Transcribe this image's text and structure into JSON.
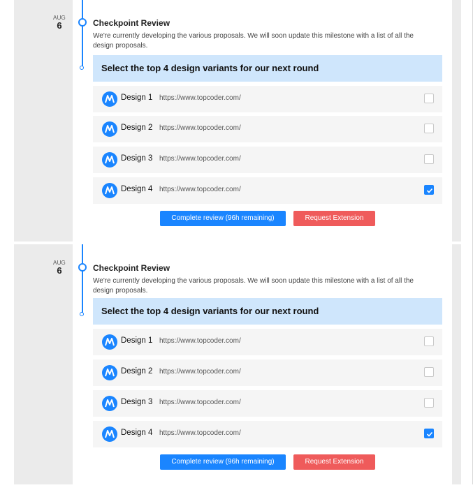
{
  "milestones": [
    {
      "date": {
        "month": "AUG",
        "day": "6"
      },
      "title": "Checkpoint Review",
      "description": "We're currently developing the various proposals. We will soon update this milestone with a list of all the design proposals.",
      "select_header": "Select the top 4 design variants for our next round",
      "designs": [
        {
          "name": "Design 1",
          "url": "https://www.topcoder.com/",
          "checked": false
        },
        {
          "name": "Design 2",
          "url": "https://www.topcoder.com/",
          "checked": false
        },
        {
          "name": "Design 3",
          "url": "https://www.topcoder.com/",
          "checked": false
        },
        {
          "name": "Design 4",
          "url": "https://www.topcoder.com/",
          "checked": true
        }
      ],
      "complete_button": "Complete review (96h remaining)",
      "extension_button": "Request Extension"
    },
    {
      "date": {
        "month": "AUG",
        "day": "6"
      },
      "title": "Checkpoint Review",
      "description": "We're currently developing the various proposals. We will soon update this milestone with a list of all the design proposals.",
      "select_header": "Select the top 4 design variants for our next round",
      "designs": [
        {
          "name": "Design 1",
          "url": "https://www.topcoder.com/",
          "checked": false
        },
        {
          "name": "Design 2",
          "url": "https://www.topcoder.com/",
          "checked": false
        },
        {
          "name": "Design 3",
          "url": "https://www.topcoder.com/",
          "checked": false
        },
        {
          "name": "Design 4",
          "url": "https://www.topcoder.com/",
          "checked": true
        }
      ],
      "complete_button": "Complete review (96h remaining)",
      "extension_button": "Request Extension"
    }
  ],
  "colors": {
    "accent": "#1a85ff",
    "header_bg": "#cfe6fc",
    "danger": "#ef5b5b",
    "row_bg": "#f5f5f5",
    "panel_bg": "#ebebeb"
  },
  "icons": {
    "design_logo": "topcoder-logo-icon",
    "checked": "checkmark-icon",
    "timeline_node": "timeline-dot-icon"
  }
}
